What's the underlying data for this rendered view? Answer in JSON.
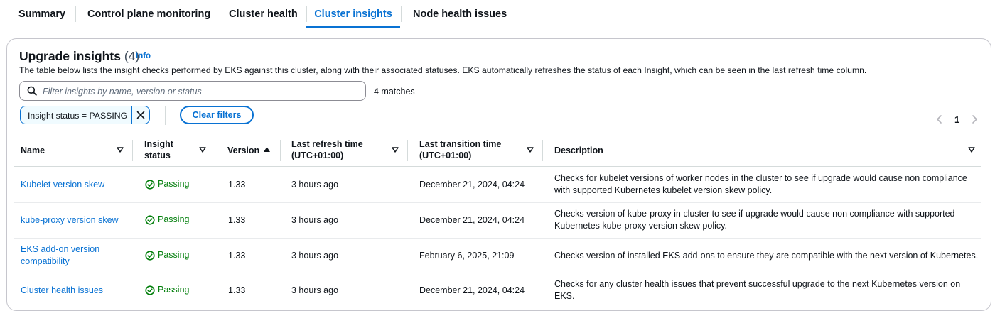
{
  "tabs": [
    {
      "label": "Summary",
      "active": false
    },
    {
      "label": "Control plane monitoring",
      "active": false
    },
    {
      "label": "Cluster health",
      "active": false
    },
    {
      "label": "Cluster insights",
      "active": true
    },
    {
      "label": "Node health issues",
      "active": false
    }
  ],
  "header": {
    "title": "Upgrade insights",
    "count": "(4)",
    "info_label": "Info",
    "description": "The table below lists the insight checks performed by EKS against this cluster, along with their associated statuses. EKS automatically refreshes the status of each Insight, which can be seen in the last refresh time column."
  },
  "filter": {
    "placeholder": "Filter insights by name, version or status",
    "value": "",
    "matches": "4 matches",
    "token_label": "Insight status = PASSING",
    "clear_label": "Clear filters"
  },
  "pagination": {
    "current_page": "1"
  },
  "table": {
    "columns": {
      "name": "Name",
      "status_line1": "Insight",
      "status_line2": "status",
      "version": "Version",
      "refresh_line1": "Last refresh time",
      "refresh_line2": "(UTC+01:00)",
      "transition_line1": "Last transition time",
      "transition_line2": "(UTC+01:00)",
      "description": "Description"
    },
    "rows": [
      {
        "name_line1": "Kubelet version skew",
        "name_line2": "",
        "status": "Passing",
        "version": "1.33",
        "refresh": "3 hours ago",
        "transition": "December 21, 2024, 04:24",
        "desc_line1": "Checks for kubelet versions of worker nodes in the cluster to see if upgrade would cause non compliance",
        "desc_line2": "with supported Kubernetes kubelet version skew policy."
      },
      {
        "name_line1": "kube-proxy version skew",
        "name_line2": "",
        "status": "Passing",
        "version": "1.33",
        "refresh": "3 hours ago",
        "transition": "December 21, 2024, 04:24",
        "desc_line1": "Checks version of kube-proxy in cluster to see if upgrade would cause non compliance with supported",
        "desc_line2": "Kubernetes kube-proxy version skew policy."
      },
      {
        "name_line1": "EKS add-on version",
        "name_line2": "compatibility",
        "status": "Passing",
        "version": "1.33",
        "refresh": "3 hours ago",
        "transition": "February 6, 2025, 21:09",
        "desc_line1": "Checks version of installed EKS add-ons to ensure they are compatible with the next version of Kubernetes.",
        "desc_line2": ""
      },
      {
        "name_line1": "Cluster health issues",
        "name_line2": "",
        "status": "Passing",
        "version": "1.33",
        "refresh": "3 hours ago",
        "transition": "December 21, 2024, 04:24",
        "desc_line1": "Checks for any cluster health issues that prevent successful upgrade to the next Kubernetes version on",
        "desc_line2": "EKS."
      }
    ]
  },
  "colors": {
    "link": "#0972d3",
    "success": "#037f0c",
    "border": "#c6c6cd",
    "text": "#0f141a"
  },
  "icons": {
    "search": "search-icon",
    "close": "close-icon",
    "prev": "chevron-left-icon",
    "next": "chevron-right-icon",
    "sort_desc": "caret-down-icon",
    "sort_asc": "caret-up-icon",
    "status_ok": "status-positive-icon"
  }
}
